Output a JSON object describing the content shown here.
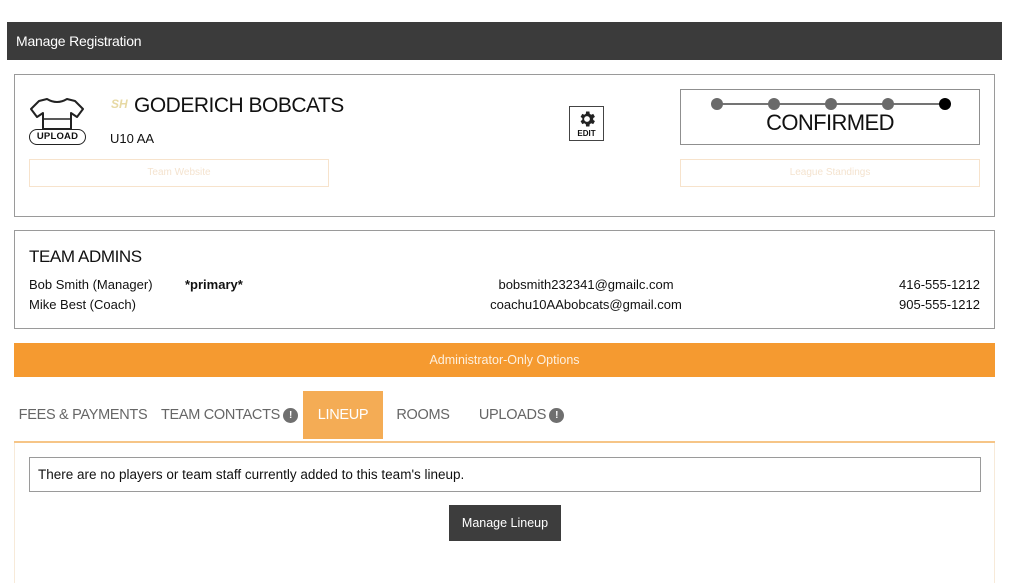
{
  "header": {
    "title": "Manage Registration"
  },
  "team": {
    "name": "GODERICH BOBCATS",
    "division": "U10 AA",
    "upload_label": "UPLOAD",
    "edit_label": "EDIT",
    "logo_text": "SH",
    "status": "CONFIRMED",
    "progress": {
      "total_steps": 5,
      "current_step": 5
    },
    "website_label": "Team Website",
    "standings_label": "League Standings"
  },
  "admins": {
    "title": "TEAM ADMINS",
    "rows": [
      {
        "name": "Bob Smith (Manager)",
        "primary": "*primary*",
        "email": "bobsmith232341@gmailc.com",
        "phone": "416-555-1212"
      },
      {
        "name": "Mike Best (Coach)",
        "primary": "",
        "email": "coachu10AAbobcats@gmail.com",
        "phone": "905-555-1212"
      }
    ]
  },
  "admin_options": {
    "label": "Administrator-Only Options"
  },
  "tabs": [
    {
      "label": "FEES & PAYMENTS",
      "badge": ""
    },
    {
      "label": "TEAM CONTACTS",
      "badge": "!"
    },
    {
      "label": "LINEUP",
      "badge": "",
      "active": true
    },
    {
      "label": "ROOMS",
      "badge": ""
    },
    {
      "label": "UPLOADS",
      "badge": "!"
    }
  ],
  "lineup": {
    "empty_message": "There are no players or team staff currently added to this team's lineup.",
    "manage_button": "Manage Lineup"
  },
  "colors": {
    "header_bg": "#3b3b3b",
    "accent_orange": "#f59a30",
    "active_tab": "#f4ac55",
    "dark_button": "#3d3d3d"
  }
}
